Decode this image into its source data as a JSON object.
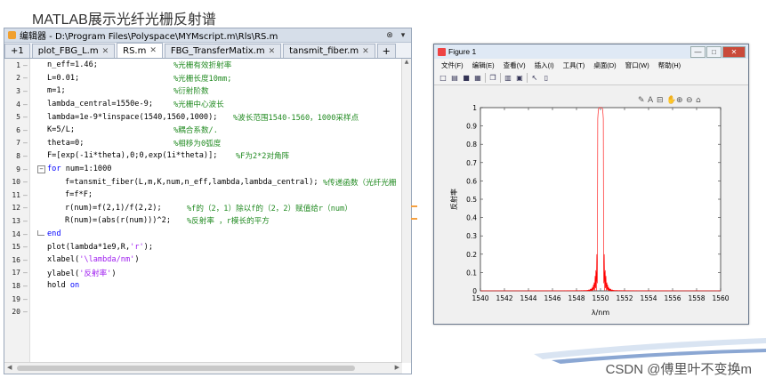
{
  "page_title": "MATLAB展示光纤光栅反射谱",
  "editor": {
    "title": "编辑器 - D:\\Program Files\\Polyspace\\MYMscript.m\\Rls\\RS.m",
    "tabs": [
      {
        "label": "+1",
        "active": false
      },
      {
        "label": "plot_FBG_L.m",
        "active": false
      },
      {
        "label": "RS.m",
        "active": true
      },
      {
        "label": "FBG_TransferMatix.m",
        "active": false
      },
      {
        "label": "tansmit_fiber.m",
        "active": false
      }
    ],
    "add_tab": "+",
    "lines": [
      {
        "n": "1",
        "code": "n_eff=1.46;",
        "comment": "%光栅有效折射率",
        "cx": 190
      },
      {
        "n": "2",
        "code": "L=0.01;",
        "comment": "%光栅长度10mm;",
        "cx": 190
      },
      {
        "n": "3",
        "code": "m=1;",
        "comment": "%衍射阶数",
        "cx": 190
      },
      {
        "n": "4",
        "code": "lambda_central=1550e-9;",
        "comment": "%光栅中心波长",
        "cx": 190
      },
      {
        "n": "5",
        "code": "lambda=1e-9*linspace(1540,1560,1000);",
        "comment": "%波长范围1540-1560，1000采样点",
        "cx": 257
      },
      {
        "n": "6",
        "code": "K=5/L;",
        "comment": "%耦合系数/.",
        "cx": 190
      },
      {
        "n": "7",
        "code": "theta=0;",
        "comment": "%相移为0弧度",
        "cx": 190
      },
      {
        "n": "8",
        "code": "F=[exp(-1i*theta),0;0,exp(1i*theta)];",
        "comment": "%F为2*2对角阵",
        "cx": 260
      },
      {
        "n": "9",
        "kw": "for",
        "code": " num=1:1000",
        "fold": "-"
      },
      {
        "n": "10",
        "indent": true,
        "code": "f=tansmit_fiber(L,m,K,num,n_eff,lambda,lambda_central);",
        "comment": "%传递函数（光纤光栅",
        "cx": 358
      },
      {
        "n": "11",
        "indent": true,
        "code": "f=f*F;"
      },
      {
        "n": "12",
        "indent": true,
        "code": "r(num)=f(2,1)/f(2,2);",
        "comment": "%f的（2，1）除以f的（2，2）赋值给r（num）",
        "cx": 205
      },
      {
        "n": "13",
        "indent": true,
        "code": "R(num)=(abs(r(num)))^2;",
        "comment": "%反射率 ，r模长的平方",
        "cx": 205
      },
      {
        "n": "14",
        "kw": "end",
        "code": "",
        "fold": "end"
      },
      {
        "n": "15",
        "code": "plot(lambda*1e9,R,",
        "str": "'r'",
        "tail": ");"
      },
      {
        "n": "16",
        "code": "xlabel(",
        "str": "'\\lambda/nm'",
        "tail": ")"
      },
      {
        "n": "17",
        "code": "ylabel(",
        "str": "'反射率'",
        "tail": ")"
      },
      {
        "n": "18",
        "code": "hold ",
        "kw2": "on"
      },
      {
        "n": "19",
        "code": ""
      },
      {
        "n": "20",
        "code": ""
      }
    ]
  },
  "figure": {
    "title": "Figure 1",
    "menus": [
      "文件(F)",
      "编辑(E)",
      "查看(V)",
      "插入(I)",
      "工具(T)",
      "桌面(D)",
      "窗口(W)",
      "帮助(H)"
    ],
    "toolbar_icons": [
      "new-file-icon",
      "open-icon",
      "save-icon",
      "print-icon",
      "copy-icon",
      "data-cursor-icon",
      "arrow-icon",
      "window-icon"
    ],
    "axes_toolbar_icons": [
      "brush-icon",
      "insert-text-icon",
      "rotate-icon",
      "pan-icon",
      "zoom-in-icon",
      "zoom-out-icon",
      "home-icon"
    ],
    "win_controls": {
      "min": "—",
      "max": "□",
      "close": "✕"
    }
  },
  "chart_data": {
    "type": "line",
    "xlabel": "λ/nm",
    "ylabel": "反射率",
    "xlim": [
      1540,
      1560
    ],
    "ylim": [
      0,
      1
    ],
    "xticks": [
      1540,
      1542,
      1544,
      1546,
      1548,
      1550,
      1552,
      1554,
      1556,
      1558,
      1560
    ],
    "yticks": [
      0,
      0.1,
      0.2,
      0.3,
      0.4,
      0.5,
      0.6,
      0.7,
      0.8,
      0.9,
      1
    ],
    "grid": false,
    "series": [
      {
        "color": "#ff0000",
        "peak_center": 1550,
        "peak_value": 1.0,
        "main_lobe_halfwidth": 0.25
      }
    ]
  },
  "watermark": "CSDN @傅里叶不变换m"
}
